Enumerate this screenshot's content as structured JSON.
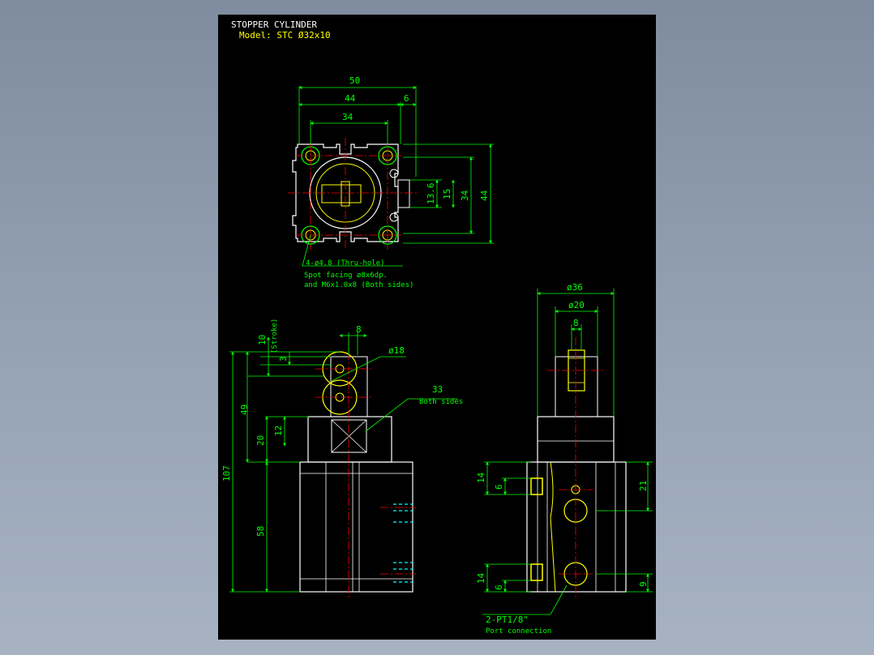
{
  "title": {
    "name": "STOPPER CYLINDER",
    "model": "Model: STC Ø32x10"
  },
  "colors": {
    "sheet": "#000000",
    "outline": "#ffffff",
    "dimension": "#00ff00",
    "centerline": "#ff0000",
    "detail": "#ffff00",
    "hidden": "#00ffff"
  },
  "top_view": {
    "dim_overall": "50",
    "dim_pitch": "44",
    "dim_offset": "6",
    "dim_inner": "34",
    "dim_side_13_6": "13.6",
    "dim_side_15": "15",
    "dim_side_34": "34",
    "dim_side_44": "44",
    "note_holes": "4-ø4.8 (Thru-hole)",
    "note_spot": "Spot facing ø8x6dp.",
    "note_thread": "and M6x1.0x8 (Both sides)"
  },
  "front_view": {
    "dim_stroke": "10",
    "dim_stroke_label": "(Stroke)",
    "dim_3": "3",
    "dim_8": "8",
    "dim_roller": "ø18",
    "dim_33": "33",
    "note_both_sides": "Both sides",
    "dim_49": "49",
    "dim_12": "12",
    "dim_20": "20",
    "dim_107": "107",
    "dim_58": "58"
  },
  "side_view": {
    "dim_body": "ø36",
    "dim_rod": "ø20",
    "dim_8": "8",
    "dim_14_top": "14",
    "dim_6_top": "6",
    "dim_21": "21",
    "dim_14_bot": "14",
    "dim_6_bot": "6",
    "dim_9": "9",
    "note_port": "2-PT1/8\"",
    "note_port_sub": "Port connection"
  }
}
